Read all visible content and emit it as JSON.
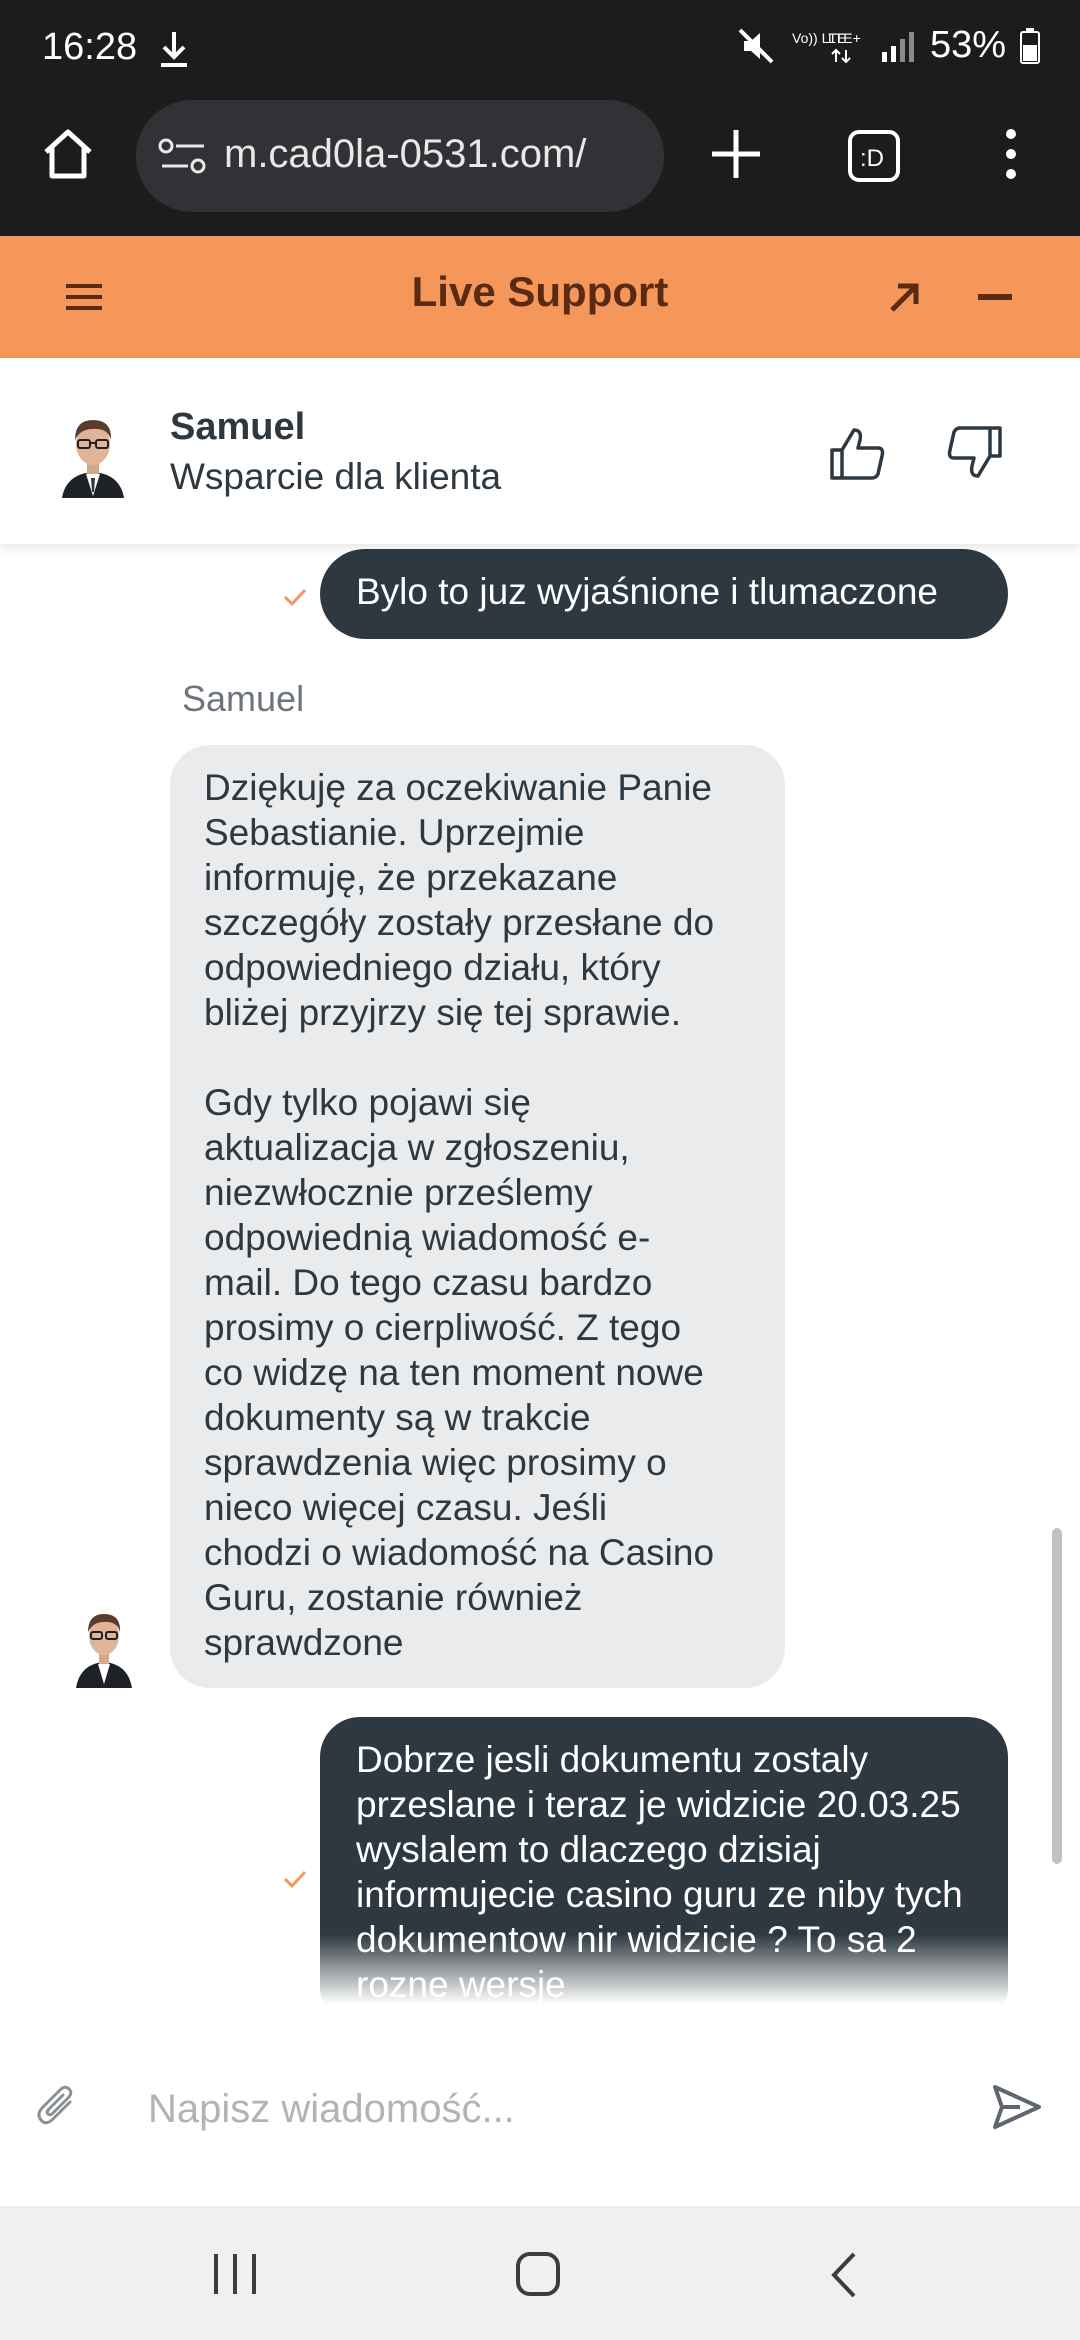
{
  "status_bar": {
    "time": "16:28",
    "battery": "53%",
    "network_1": "Vo)) LTE",
    "network_2": "LTE+"
  },
  "browser": {
    "url": "m.cad0la-0531.com/"
  },
  "support": {
    "title": "Live Support"
  },
  "agent": {
    "name": "Samuel",
    "role": "Wsparcie dla klienta"
  },
  "messages": [
    {
      "from": "user",
      "text": "Bylo to juz wyjaśnione i tlumaczone"
    },
    {
      "from": "agent",
      "sender": "Samuel",
      "text": "Dziękuję za oczekiwanie Panie\nSebastianie. Uprzejmie\ninformuję, że przekazane\nszczegóły zostały przesłane do\nodpowiedniego działu, który\nbliżej przyjrzy się tej sprawie.\n\nGdy tylko pojawi się\naktualizacja w zgłoszeniu,\nniezwłocznie prześlemy\nodpowiednią wiadomość e-\nmail. Do tego czasu bardzo\nprosimy o cierpliwość. Z tego\nco widzę na ten moment nowe\ndokumenty są w trakcie\nsprawdzenia więc prosimy o\nnieco więcej czasu. Jeśli\nchodzi o wiadomość na Casino\nGuru, zostanie również\nsprawdzone"
    },
    {
      "from": "user",
      "text": "Dobrze jesli dokumentu zostaly przeslane i teraz je widzicie 20.03.25 wyslalem to dlaczego dzisiaj informujecie casino guru ze niby tych dokumentow nir widzicie ? To sa 2 rozne wersje"
    }
  ],
  "composer": {
    "placeholder": "Napisz wiadomość..."
  },
  "colors": {
    "header_bg": "#f5965a",
    "header_text": "#5a2a12",
    "user_bubble": "#2d3840",
    "agent_bubble": "#e9ebed",
    "check": "#f5965a"
  },
  "icons": [
    "download-icon",
    "home-icon",
    "settings-icon",
    "plus-icon",
    "tabs-icon",
    "kebab-icon",
    "menu-icon",
    "popout-icon",
    "minimize-icon",
    "thumb-up-icon",
    "thumb-down-icon",
    "check-icon",
    "attach-icon",
    "send-icon"
  ]
}
